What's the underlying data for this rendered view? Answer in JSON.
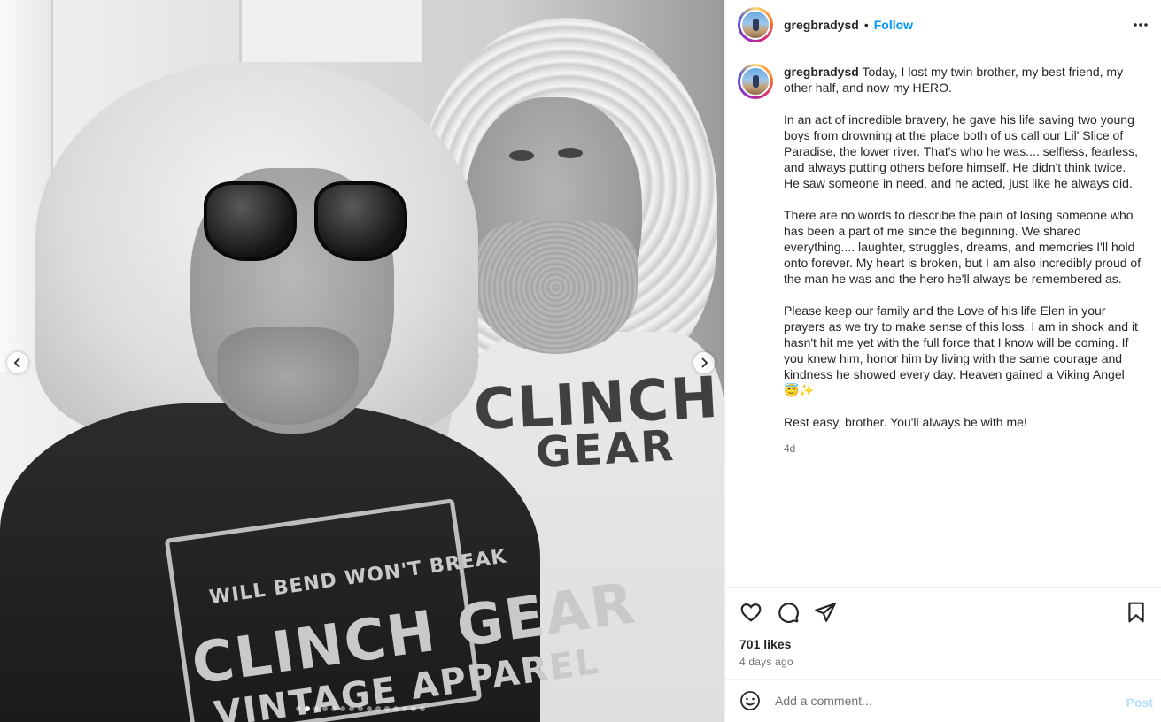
{
  "colors": {
    "accent": "#0095f6",
    "muted": "#737373",
    "text": "#262626",
    "post_disabled": "#b2dffc"
  },
  "media": {
    "shirt_left_text": [
      "WILL BEND WON'T BREAK",
      "CLINCH GEAR",
      "VINTAGE APPAREL"
    ],
    "shirt_right_text": [
      "CLINCH",
      "GEAR"
    ],
    "carousel": {
      "total": 15,
      "active_index": 1
    },
    "prev_icon": "chevron-left-icon",
    "next_icon": "chevron-right-icon"
  },
  "header": {
    "username": "gregbradysd",
    "separator": "•",
    "follow_label": "Follow",
    "more_icon": "more-horizontal-icon"
  },
  "caption": {
    "username": "gregbradysd",
    "paragraphs": [
      "Today, I lost my twin brother, my best friend, my other half, and now my HERO.",
      "In an act of incredible bravery, he gave his life saving two young boys from drowning at the place both of us call our Lil' Slice of Paradise, the lower river. That's who he was.... selfless, fearless, and always putting others before himself. He didn't think twice. He saw someone in need, and he acted, just like he always did.",
      "There are no words to describe the pain of losing someone who has been a part of me since the beginning. We shared everything.... laughter, struggles, dreams, and memories I'll hold onto forever. My heart is broken, but I am also incredibly proud of the man he was and the hero he'll always be remembered as.",
      "Please keep our family and the Love of his life Elen in your prayers as we try to make sense of this loss. I am in shock and it hasn't hit me yet with the full force that I know will be coming. If you knew him, honor him by living with the same courage and kindness he showed every day. Heaven gained a Viking Angel 😇✨",
      "Rest easy, brother. You'll always be with me!"
    ],
    "time": "4d"
  },
  "actions": {
    "icons": [
      "heart-icon",
      "comment-icon",
      "share-icon",
      "bookmark-icon"
    ],
    "likes": "701 likes",
    "posted_ago": "4 days ago"
  },
  "comment": {
    "placeholder": "Add a comment...",
    "post_label": "Post",
    "emoji_icon": "emoji-icon"
  }
}
